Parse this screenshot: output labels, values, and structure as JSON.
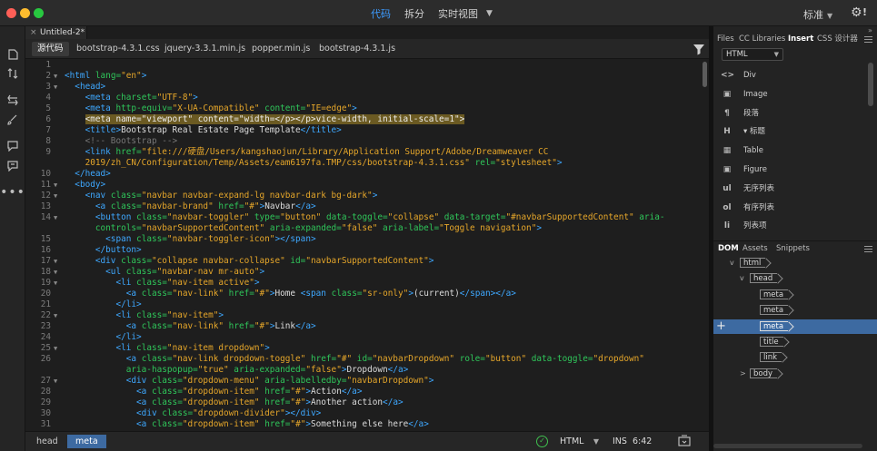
{
  "titlebar": {
    "view_modes": [
      "代码",
      "拆分",
      "实时视图"
    ],
    "active_view": "代码",
    "workspace": "标准",
    "settings_badge": "!",
    "accent_color": "#3d9bff"
  },
  "document_tab": {
    "close_glyph": "×",
    "name": "Untitled-2*"
  },
  "related_files": [
    "源代码",
    "bootstrap-4.3.1.css",
    "jquery-3.3.1.min.js",
    "popper.min.js",
    "bootstrap-4.3.1.js"
  ],
  "left_tools": [
    "file-icon",
    "sync-icon",
    "transform-icon",
    "brush-icon",
    "comment-icon",
    "dom-icon",
    "more-icon"
  ],
  "code": {
    "lines": [
      {
        "n": "1",
        "fold": "",
        "html": "<!DOCTYPE html>"
      },
      {
        "n": "2",
        "fold": "▼",
        "html": "<span class='tag'>&lt;html</span> <span class='att'>lang=</span><span class='val'>\"en\"</span><span class='tag'>&gt;</span>"
      },
      {
        "n": "3",
        "fold": "▼",
        "html": "  <span class='tag'>&lt;head&gt;</span>"
      },
      {
        "n": "4",
        "fold": "",
        "html": "    <span class='tag'>&lt;meta</span> <span class='att'>charset=</span><span class='val'>\"UTF-8\"</span><span class='tag'>&gt;</span>"
      },
      {
        "n": "5",
        "fold": "",
        "html": "    <span class='tag'>&lt;meta</span> <span class='att'>http-equiv=</span><span class='val'>\"X-UA-Compatible\"</span> <span class='att'>content=</span><span class='val'>\"IE=edge\"</span><span class='tag'>&gt;</span>"
      },
      {
        "n": "6",
        "fold": "",
        "html": "    <span class='hl'>&lt;meta name=\"viewport\" content=\"width=&lt;/p&gt;&lt;/p&gt;vice-width, initial-scale=1\"&gt;</span>"
      },
      {
        "n": "7",
        "fold": "",
        "html": "    <span class='tag'>&lt;title&gt;</span>Bootstrap Real Estate Page Template<span class='tag'>&lt;/title&gt;</span>"
      },
      {
        "n": "8",
        "fold": "",
        "html": "    <span class='cmt'>&lt;!-- Bootstrap --&gt;</span>"
      },
      {
        "n": "9",
        "fold": "",
        "html": "    <span class='tag'>&lt;link</span> <span class='att'>href=</span><span class='val'>\"file:///硬盘/Users/kangshaojun/Library/Application Support/Adobe/Dreamweaver CC</span>"
      },
      {
        "n": "",
        "fold": "",
        "html": "    <span class='val'>2019/zh_CN/Configuration/Temp/Assets/eam6197fa.TMP/css/bootstrap-4.3.1.css\"</span> <span class='att'>rel=</span><span class='val'>\"stylesheet\"</span><span class='tag'>&gt;</span>"
      },
      {
        "n": "10",
        "fold": "",
        "html": "  <span class='tag'>&lt;/head&gt;</span>"
      },
      {
        "n": "11",
        "fold": "▼",
        "html": "  <span class='tag'>&lt;body&gt;</span>"
      },
      {
        "n": "12",
        "fold": "▼",
        "html": "    <span class='tag'>&lt;nav</span> <span class='att'>class=</span><span class='val'>\"navbar navbar-expand-lg navbar-dark bg-dark\"</span><span class='tag'>&gt;</span>"
      },
      {
        "n": "13",
        "fold": "",
        "html": "      <span class='tag'>&lt;a</span> <span class='att'>class=</span><span class='val'>\"navbar-brand\"</span> <span class='att'>href=</span><span class='val'>\"#\"</span><span class='tag'>&gt;</span>Navbar<span class='tag'>&lt;/a&gt;</span>"
      },
      {
        "n": "14",
        "fold": "▼",
        "html": "      <span class='tag'>&lt;button</span> <span class='att'>class=</span><span class='val'>\"navbar-toggler\"</span> <span class='att'>type=</span><span class='val'>\"button\"</span> <span class='att'>data-toggle=</span><span class='val'>\"collapse\"</span> <span class='att'>data-target=</span><span class='val'>\"#navbarSupportedContent\"</span> <span class='att'>aria-</span>"
      },
      {
        "n": "",
        "fold": "",
        "html": "      <span class='att'>controls=</span><span class='val'>\"navbarSupportedContent\"</span> <span class='att'>aria-expanded=</span><span class='val'>\"false\"</span> <span class='att'>aria-label=</span><span class='val'>\"Toggle navigation\"</span><span class='tag'>&gt;</span>"
      },
      {
        "n": "15",
        "fold": "",
        "html": "        <span class='tag'>&lt;span</span> <span class='att'>class=</span><span class='val'>\"navbar-toggler-icon\"</span><span class='tag'>&gt;&lt;/span&gt;</span>"
      },
      {
        "n": "16",
        "fold": "",
        "html": "      <span class='tag'>&lt;/button&gt;</span>"
      },
      {
        "n": "17",
        "fold": "▼",
        "html": "      <span class='tag'>&lt;div</span> <span class='att'>class=</span><span class='val'>\"collapse navbar-collapse\"</span> <span class='att'>id=</span><span class='val'>\"navbarSupportedContent\"</span><span class='tag'>&gt;</span>"
      },
      {
        "n": "18",
        "fold": "▼",
        "html": "        <span class='tag'>&lt;ul</span> <span class='att'>class=</span><span class='val'>\"navbar-nav mr-auto\"</span><span class='tag'>&gt;</span>"
      },
      {
        "n": "19",
        "fold": "▼",
        "html": "          <span class='tag'>&lt;li</span> <span class='att'>class=</span><span class='val'>\"nav-item active\"</span><span class='tag'>&gt;</span>"
      },
      {
        "n": "20",
        "fold": "",
        "html": "            <span class='tag'>&lt;a</span> <span class='att'>class=</span><span class='val'>\"nav-link\"</span> <span class='att'>href=</span><span class='val'>\"#\"</span><span class='tag'>&gt;</span>Home <span class='tag'>&lt;span</span> <span class='att'>class=</span><span class='val'>\"sr-only\"</span><span class='tag'>&gt;</span>(current)<span class='tag'>&lt;/span&gt;&lt;/a&gt;</span>"
      },
      {
        "n": "21",
        "fold": "",
        "html": "          <span class='tag'>&lt;/li&gt;</span>"
      },
      {
        "n": "22",
        "fold": "▼",
        "html": "          <span class='tag'>&lt;li</span> <span class='att'>class=</span><span class='val'>\"nav-item\"</span><span class='tag'>&gt;</span>"
      },
      {
        "n": "23",
        "fold": "",
        "html": "            <span class='tag'>&lt;a</span> <span class='att'>class=</span><span class='val'>\"nav-link\"</span> <span class='att'>href=</span><span class='val'>\"#\"</span><span class='tag'>&gt;</span>Link<span class='tag'>&lt;/a&gt;</span>"
      },
      {
        "n": "24",
        "fold": "",
        "html": "          <span class='tag'>&lt;/li&gt;</span>"
      },
      {
        "n": "25",
        "fold": "▼",
        "html": "          <span class='tag'>&lt;li</span> <span class='att'>class=</span><span class='val'>\"nav-item dropdown\"</span><span class='tag'>&gt;</span>"
      },
      {
        "n": "26",
        "fold": "",
        "html": "            <span class='tag'>&lt;a</span> <span class='att'>class=</span><span class='val'>\"nav-link dropdown-toggle\"</span> <span class='att'>href=</span><span class='val'>\"#\"</span> <span class='att'>id=</span><span class='val'>\"navbarDropdown\"</span> <span class='att'>role=</span><span class='val'>\"button\"</span> <span class='att'>data-toggle=</span><span class='val'>\"dropdown\"</span>"
      },
      {
        "n": "",
        "fold": "",
        "html": "            <span class='att'>aria-haspopup=</span><span class='val'>\"true\"</span> <span class='att'>aria-expanded=</span><span class='val'>\"false\"</span><span class='tag'>&gt;</span>Dropdown<span class='tag'>&lt;/a&gt;</span>"
      },
      {
        "n": "27",
        "fold": "▼",
        "html": "            <span class='tag'>&lt;div</span> <span class='att'>class=</span><span class='val'>\"dropdown-menu\"</span> <span class='att'>aria-labelledby=</span><span class='val'>\"navbarDropdown\"</span><span class='tag'>&gt;</span>"
      },
      {
        "n": "28",
        "fold": "",
        "html": "              <span class='tag'>&lt;a</span> <span class='att'>class=</span><span class='val'>\"dropdown-item\"</span> <span class='att'>href=</span><span class='val'>\"#\"</span><span class='tag'>&gt;</span>Action<span class='tag'>&lt;/a&gt;</span>"
      },
      {
        "n": "29",
        "fold": "",
        "html": "              <span class='tag'>&lt;a</span> <span class='att'>class=</span><span class='val'>\"dropdown-item\"</span> <span class='att'>href=</span><span class='val'>\"#\"</span><span class='tag'>&gt;</span>Another action<span class='tag'>&lt;/a&gt;</span>"
      },
      {
        "n": "30",
        "fold": "",
        "html": "              <span class='tag'>&lt;div</span> <span class='att'>class=</span><span class='val'>\"dropdown-divider\"</span><span class='tag'>&gt;&lt;/div&gt;</span>"
      },
      {
        "n": "31",
        "fold": "",
        "html": "              <span class='tag'>&lt;a</span> <span class='att'>class=</span><span class='val'>\"dropdown-item\"</span> <span class='att'>href=</span><span class='val'>\"#\"</span><span class='tag'>&gt;</span>Something else here<span class='tag'>&lt;/a&gt;</span>"
      }
    ]
  },
  "status": {
    "breadcrumbs": [
      "head",
      "meta"
    ],
    "active_crumb": "meta",
    "language": "HTML",
    "mode": "INS",
    "cursor": "6:42"
  },
  "panel": {
    "tabs": [
      "Files",
      "CC Libraries",
      "Insert",
      "CSS 设计器"
    ],
    "active_tab": "Insert",
    "insert_category": "HTML",
    "insert_items": [
      {
        "icon": "div-icon",
        "glyph": "<>",
        "label": "Div"
      },
      {
        "icon": "image-icon",
        "glyph": "▣",
        "label": "Image"
      },
      {
        "icon": "paragraph-icon",
        "glyph": "¶",
        "label": "段落"
      },
      {
        "icon": "heading-icon",
        "glyph": "H",
        "label": "▾ 标题"
      },
      {
        "icon": "table-icon",
        "glyph": "▦",
        "label": "Table"
      },
      {
        "icon": "figure-icon",
        "glyph": "▣",
        "label": "Figure"
      },
      {
        "icon": "unordered-list-icon",
        "glyph": "ul",
        "label": "无序列表"
      },
      {
        "icon": "ordered-list-icon",
        "glyph": "ol",
        "label": "有序列表"
      },
      {
        "icon": "list-item-icon",
        "glyph": "li",
        "label": "列表项"
      }
    ],
    "dom_tabs": [
      "DOM",
      "Assets",
      "Snippets"
    ],
    "active_dom_tab": "DOM",
    "dom_add_glyph": "+",
    "dom_tree": [
      {
        "label": "html",
        "depth": 0,
        "toggle": "v",
        "selected": false
      },
      {
        "label": "head",
        "depth": 1,
        "toggle": "v",
        "selected": false
      },
      {
        "label": "meta",
        "depth": 2,
        "toggle": "",
        "selected": false
      },
      {
        "label": "meta",
        "depth": 2,
        "toggle": "",
        "selected": false
      },
      {
        "label": "meta",
        "depth": 2,
        "toggle": "",
        "selected": true
      },
      {
        "label": "title",
        "depth": 2,
        "toggle": "",
        "selected": false
      },
      {
        "label": "link",
        "depth": 2,
        "toggle": "",
        "selected": false
      },
      {
        "label": "body",
        "depth": 1,
        "toggle": ">",
        "selected": false
      }
    ]
  }
}
